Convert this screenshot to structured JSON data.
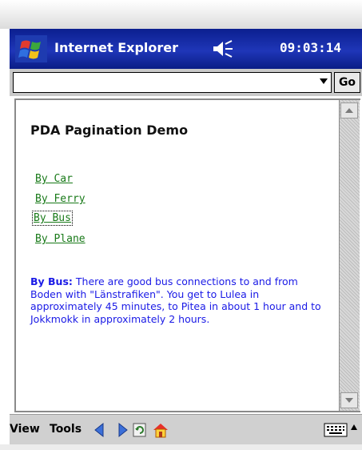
{
  "titlebar": {
    "app_title": "Internet Explorer",
    "clock": "09:03:14",
    "start_icon": "windows-flag-icon",
    "volume_icon": "speaker-icon"
  },
  "addressbar": {
    "value": "",
    "dropdown_icon": "chevron-down-icon",
    "go_label": "Go"
  },
  "page": {
    "title": "PDA Pagination Demo",
    "links": [
      {
        "label": "By Car"
      },
      {
        "label": "By Ferry"
      },
      {
        "label": "By Bus"
      },
      {
        "label": "By Plane"
      }
    ],
    "focused_link": "By Bus",
    "description_heading": "By Bus:",
    "description_body": "There are good bus connections to and from Boden with \"Länstrafiken\". You get to Lulea in approximately 45 minutes, to Pitea in about 1 hour and to Jokkmokk in approximately 2 hours."
  },
  "colors": {
    "titlebar": "#1f36b8",
    "link": "#197a19",
    "description": "#1a1ae6"
  },
  "commandbar": {
    "menu_view": "View",
    "menu_tools": "Tools",
    "icons": [
      "back-arrow-icon",
      "forward-arrow-icon",
      "refresh-icon",
      "home-icon",
      "keyboard-icon",
      "chevron-up-icon"
    ]
  }
}
